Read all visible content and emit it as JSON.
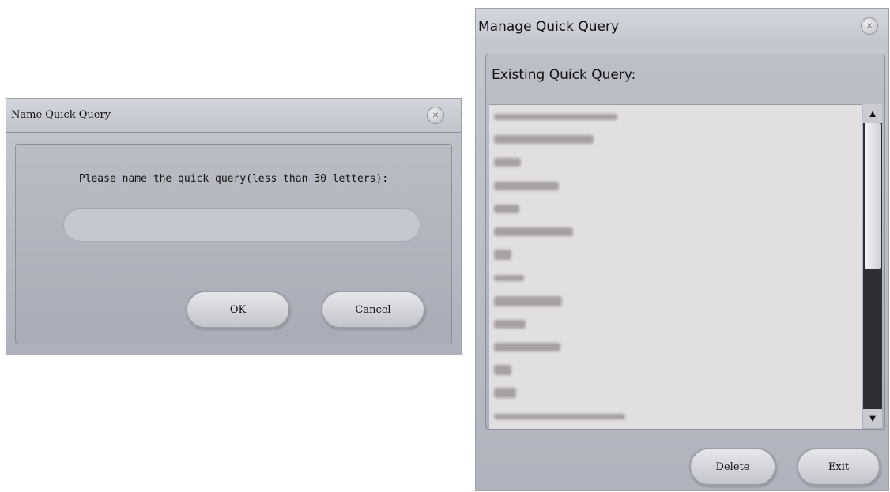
{
  "name_dialog": {
    "title": "Name Quick Query",
    "prompt": "Please name the quick query(less than 30 letters):",
    "input_value": "",
    "ok_label": "OK",
    "cancel_label": "Cancel",
    "close_icon": "×"
  },
  "manage_dialog": {
    "title": "Manage Quick Query",
    "existing_label": "Existing Quick Query:",
    "close_icon": "×",
    "delete_label": "Delete",
    "exit_label": "Exit",
    "scroll_up_icon": "▲",
    "scroll_down_icon": "▼"
  },
  "colors": {
    "dialog_background": "#b9bcc5",
    "list_background": "#e2dfe0",
    "scrollbar_track": "#2f2f33"
  }
}
